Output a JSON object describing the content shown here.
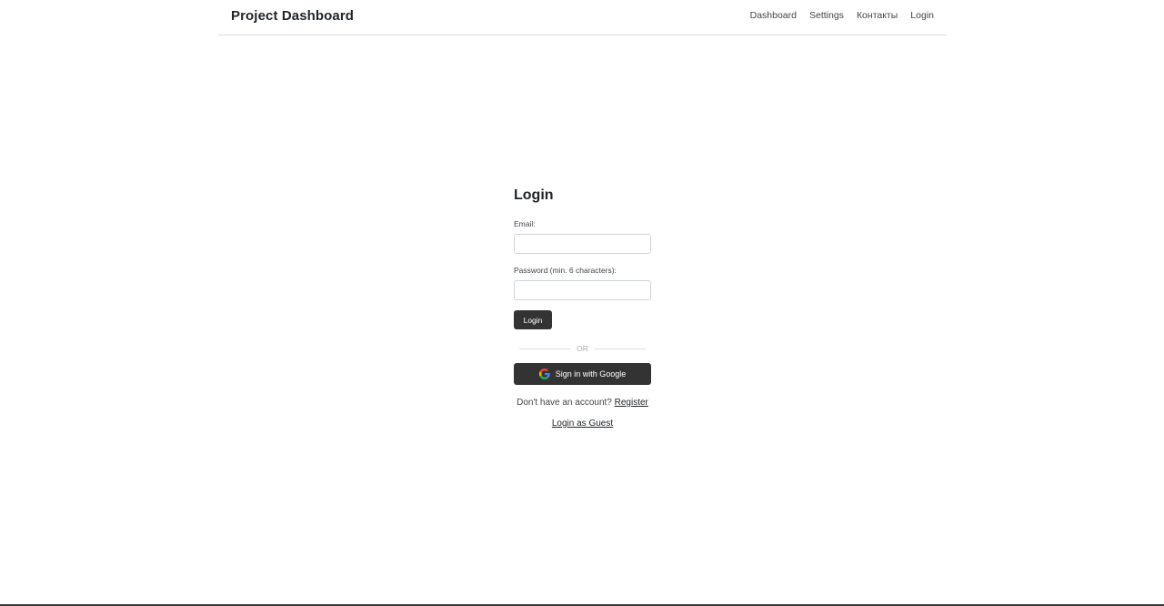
{
  "navbar": {
    "brand": "Project Dashboard",
    "links": [
      {
        "label": "Dashboard"
      },
      {
        "label": "Settings"
      },
      {
        "label": "Контакты"
      },
      {
        "label": "Login"
      }
    ]
  },
  "login": {
    "title": "Login",
    "email_label": "Email:",
    "email_value": "",
    "password_label": "Password (min. 6 characters):",
    "password_value": "",
    "submit_label": "Login",
    "divider_text": "OR",
    "google_label": "Sign in with Google",
    "google_icon": "google-g-icon",
    "register_prompt": "Don't have an account?",
    "register_link": "Register",
    "guest_link": "Login as Guest"
  },
  "colors": {
    "button_bg": "#333333",
    "nav_border": "#d9d9d9"
  }
}
